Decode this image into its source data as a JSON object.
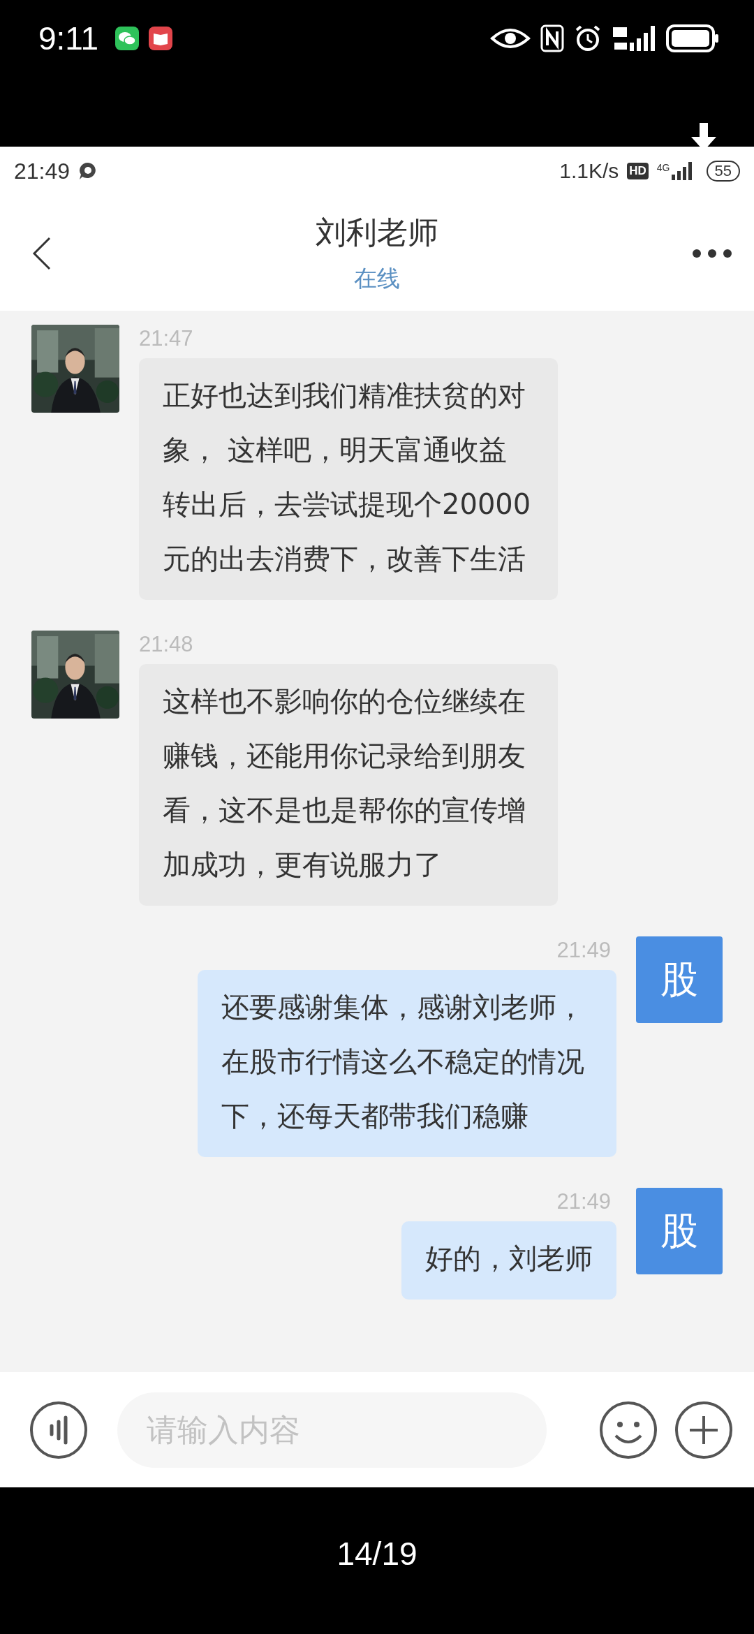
{
  "system_status": {
    "time": "9:11"
  },
  "inner_status": {
    "time": "21:49",
    "speed": "1.1K/s",
    "hd": "HD",
    "network": "4G",
    "battery": "55"
  },
  "header": {
    "title": "刘利老师",
    "subtitle": "在线"
  },
  "messages": [
    {
      "kind": "incoming",
      "time": "21:47",
      "text": "正好也达到我们精准扶贫的对象， 这样吧，明天富通收益转出后，去尝试提现个20000元的出去消费下，改善下生活"
    },
    {
      "kind": "incoming",
      "time": "21:48",
      "text": "这样也不影响你的仓位继续在赚钱，还能用你记录给到朋友看，这不是也是帮你的宣传增加成功，更有说服力了"
    },
    {
      "kind": "outgoing",
      "time": "21:49",
      "avatar_text": "股",
      "text": "还要感谢集体，感谢刘老师，在股市行情这么不稳定的情况下，还每天都带我们稳赚"
    },
    {
      "kind": "outgoing",
      "time": "21:49",
      "avatar_text": "股",
      "text": "好的，刘老师"
    }
  ],
  "input": {
    "placeholder": "请输入内容"
  },
  "viewer": {
    "counter": "14/19"
  }
}
